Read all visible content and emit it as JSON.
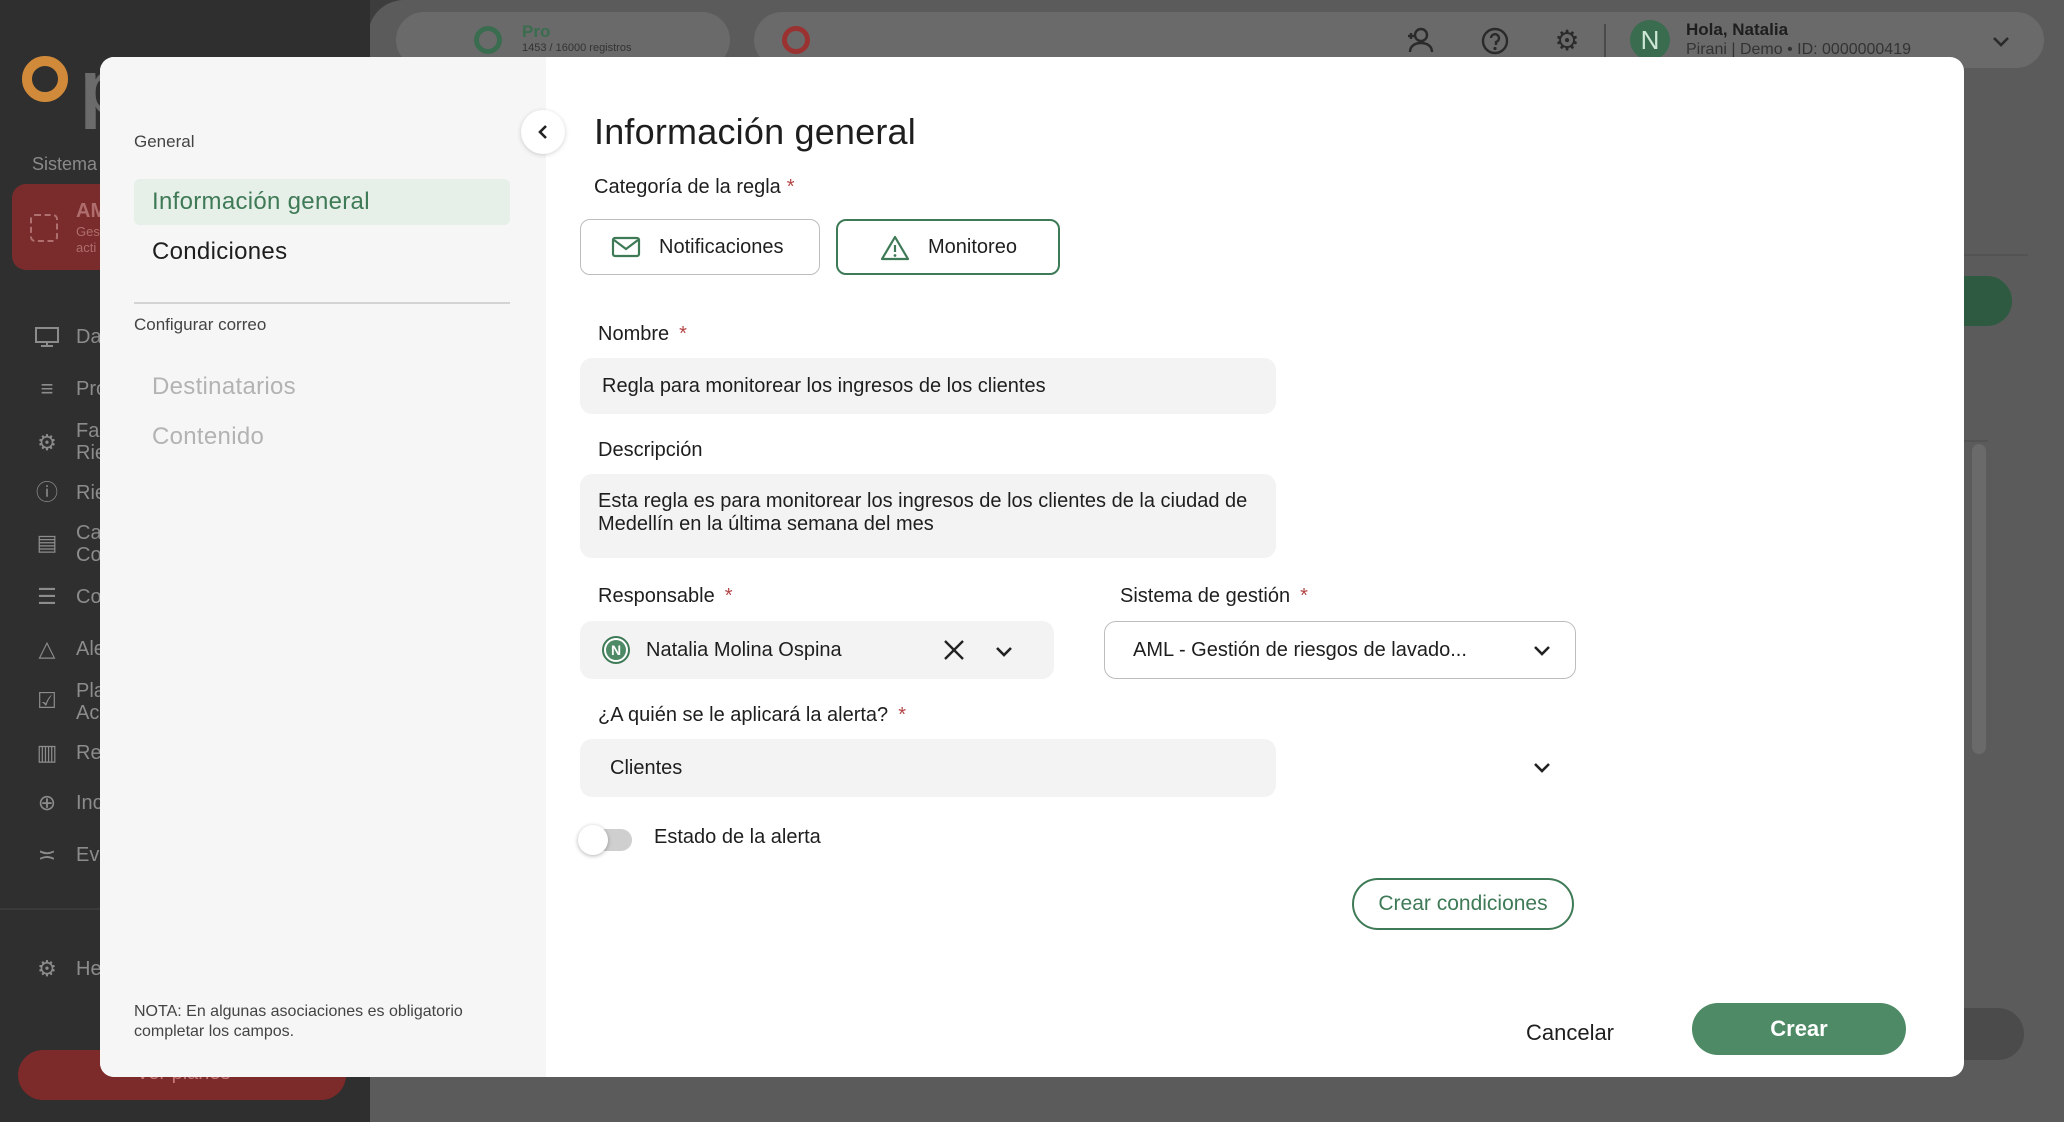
{
  "background": {
    "app_logo_text": "p",
    "sidebar_label": "Sistema",
    "sidebar_active": {
      "title": "AM",
      "sub1": "Ges",
      "sub2": "acti"
    },
    "sidebar_items": [
      "Da",
      "Pro",
      "Fac",
      "Rie",
      "Ca",
      "Co",
      "Ale",
      "Pla",
      "Re",
      "Inc",
      "Eva"
    ],
    "sidebar_items_line2": {
      "2": "Rie",
      "4": "Co",
      "7": "Ac"
    },
    "sidebar_help": "He",
    "sidebar_plans_btn": "Ver planes",
    "plan_name": "Pro",
    "plan_usage": "1453 / 16000 registros",
    "user_greeting": "Hola, Natalia",
    "user_company": "Pirani | Demo • ID: 0000000419",
    "user_initial": "N"
  },
  "modal": {
    "nav": {
      "section_general": "General",
      "item_info": "Información general",
      "item_conditions": "Condiciones",
      "section_email": "Configurar correo",
      "item_recipients": "Destinatarios",
      "item_content": "Contenido",
      "note": "NOTA: En algunas asociaciones es obligatorio completar los campos."
    },
    "title": "Información general",
    "category": {
      "label": "Categoría de la regla",
      "required": "*",
      "options": [
        "Notificaciones",
        "Monitoreo"
      ],
      "selected": "Monitoreo"
    },
    "name": {
      "label": "Nombre",
      "required": "*",
      "value": "Regla para monitorear los ingresos de los clientes"
    },
    "description": {
      "label": "Descripción",
      "value": "Esta regla es para monitorear los ingresos de los clientes de la ciudad de Medellín en la última semana del mes"
    },
    "responsible": {
      "label": "Responsable",
      "required": "*",
      "initial": "N",
      "value": "Natalia Molina Ospina"
    },
    "management_system": {
      "label": "Sistema de gestión",
      "required": "*",
      "value": "AML - Gestión de riesgos de lavado..."
    },
    "applies_to": {
      "label": "¿A quién se le aplicará la alerta?",
      "required": "*",
      "value": "Clientes"
    },
    "alert_state": {
      "label": "Estado de la alerta",
      "enabled": false
    },
    "create_conditions_button": "Crear condiciones",
    "cancel_button": "Cancelar",
    "create_button": "Crear"
  },
  "colors": {
    "accent_green": "#3f7a57",
    "primary_button": "#4d8a65",
    "required_red": "#b44545",
    "overlay_dark": "#3d3d3d"
  }
}
